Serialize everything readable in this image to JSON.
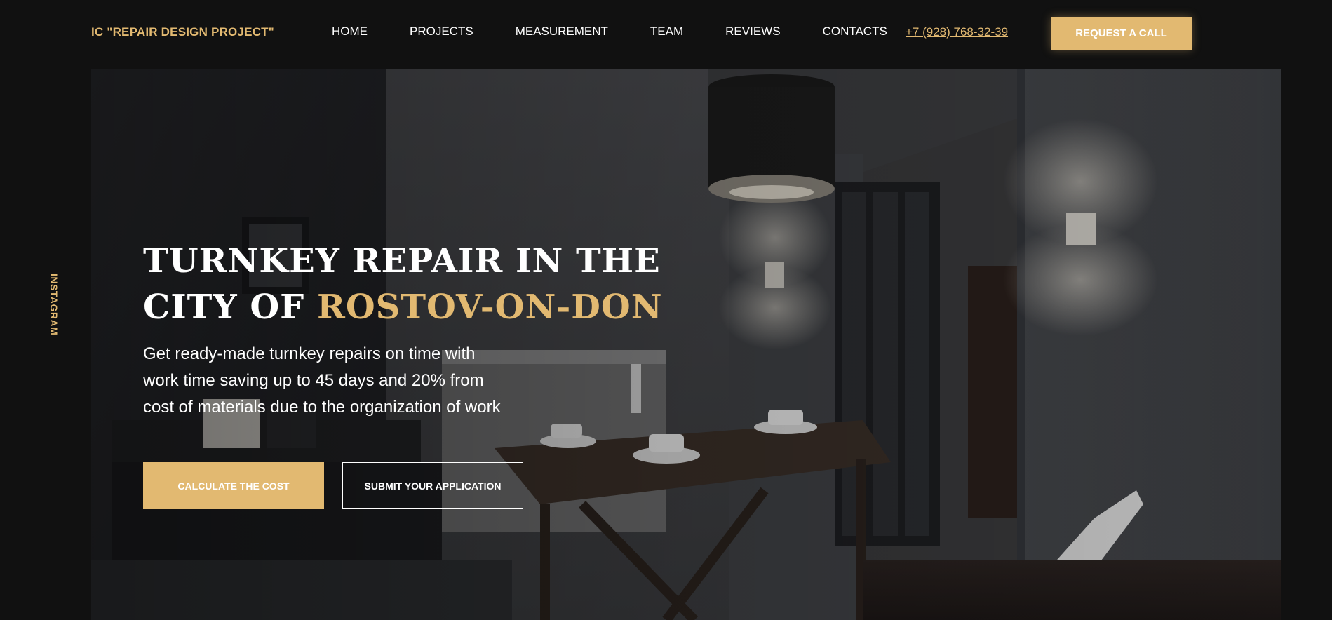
{
  "header": {
    "logo": "IC \"REPAIR DESIGN PROJECT\"",
    "nav": [
      "HOME",
      "PROJECTS",
      "MEASUREMENT",
      "TEAM",
      "REVIEWS",
      "CONTACTS"
    ],
    "phone": "+7 (928) 768-32-39",
    "request_button": "REQUEST A CALL"
  },
  "side": {
    "instagram": "INSTAGRAM"
  },
  "hero": {
    "title_line1": "TURNKEY REPAIR IN THE",
    "title_line2_prefix": "CITY OF ",
    "title_line2_accent": "ROSTOV-ON-DON",
    "subtitle": "Get ready-made turnkey repairs on time with work time saving up to 45 days and 20% from cost of materials due to the organization of work",
    "calc_button": "CALCULATE THE COST",
    "submit_button": "SUBMIT YOUR APPLICATION"
  },
  "colors": {
    "accent": "#e2b971",
    "background": "#111111",
    "text": "#ffffff"
  }
}
